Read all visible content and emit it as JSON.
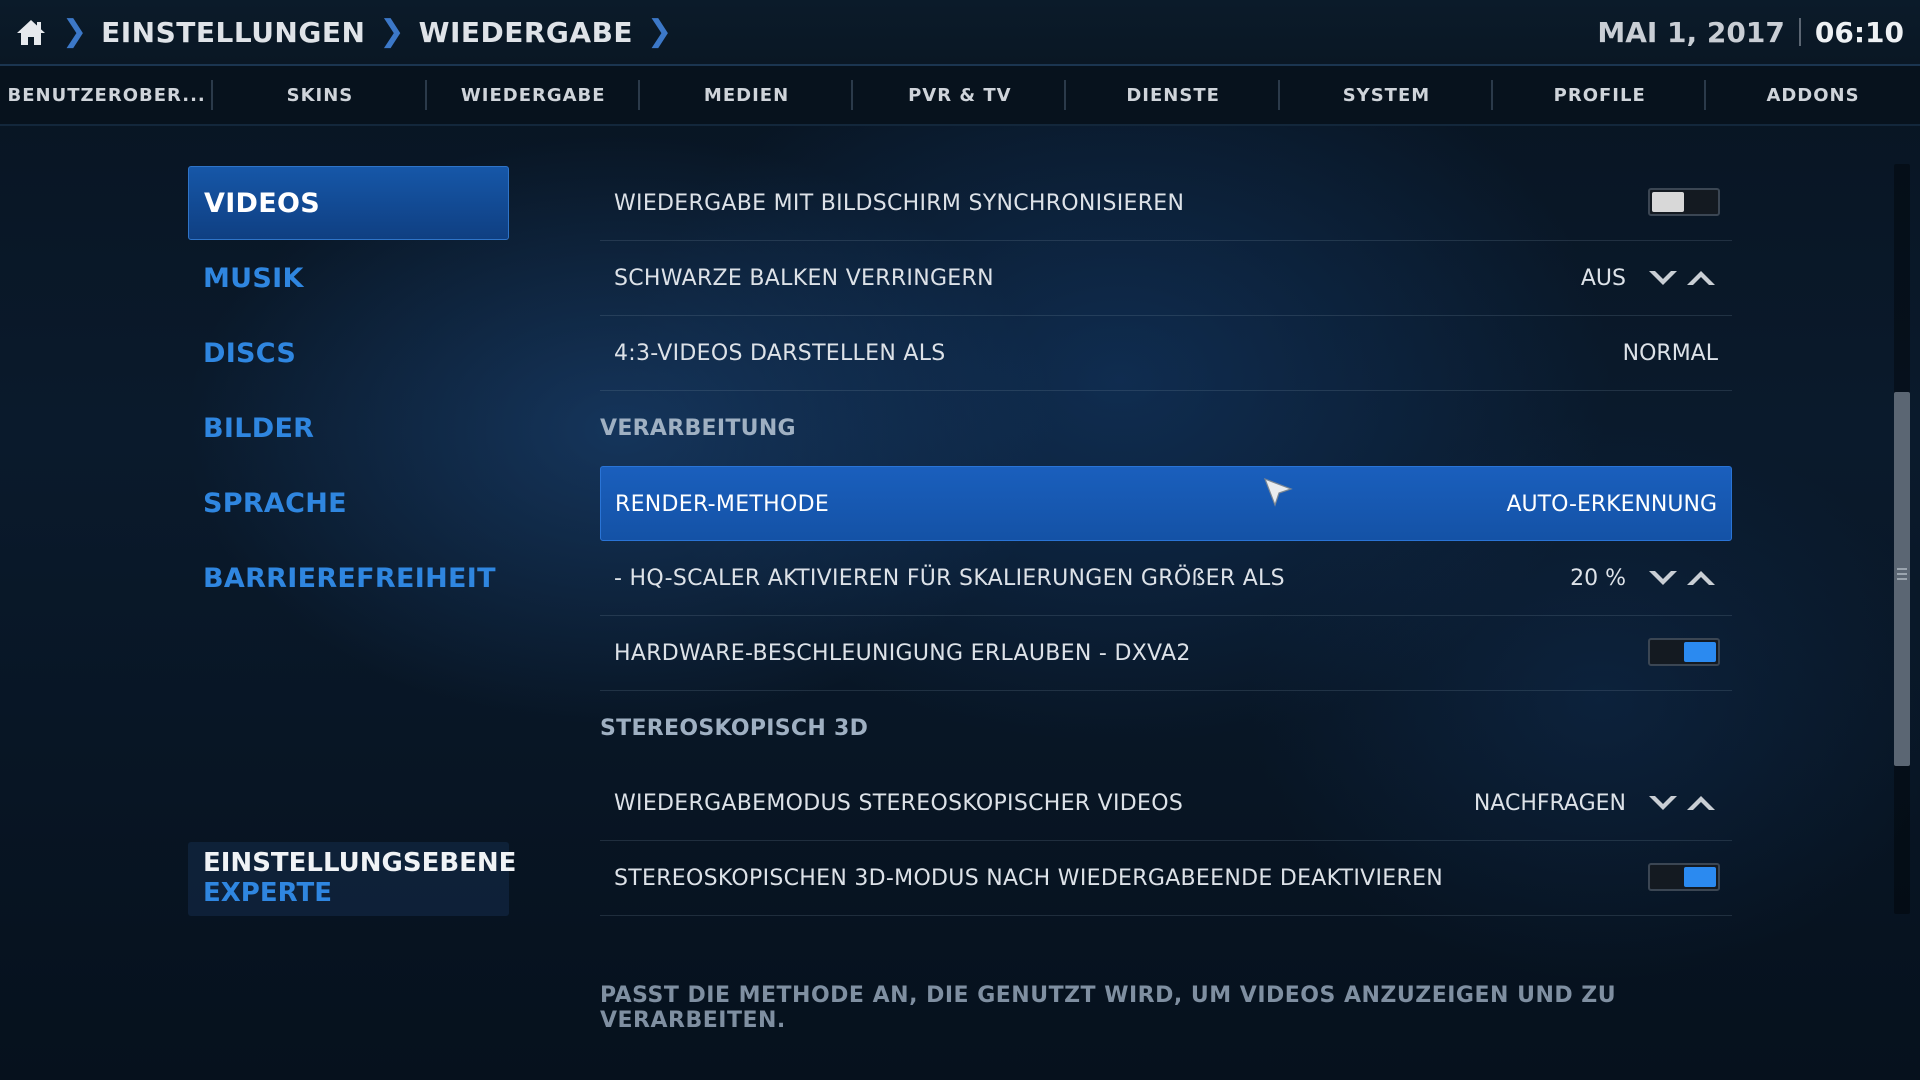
{
  "header": {
    "breadcrumbs": [
      "EINSTELLUNGEN",
      "WIEDERGABE"
    ],
    "date": "MAI 1, 2017",
    "time": "06:10"
  },
  "tabs": [
    {
      "label": "BENUTZEROBER...",
      "active": false
    },
    {
      "label": "SKINS",
      "active": false
    },
    {
      "label": "WIEDERGABE",
      "active": true
    },
    {
      "label": "MEDIEN",
      "active": false
    },
    {
      "label": "PVR & TV",
      "active": false
    },
    {
      "label": "DIENSTE",
      "active": false
    },
    {
      "label": "SYSTEM",
      "active": false
    },
    {
      "label": "PROFILE",
      "active": false
    },
    {
      "label": "ADDONS",
      "active": false
    }
  ],
  "categories": [
    {
      "label": "VIDEOS",
      "active": true
    },
    {
      "label": "MUSIK",
      "active": false
    },
    {
      "label": "DISCS",
      "active": false
    },
    {
      "label": "BILDER",
      "active": false
    },
    {
      "label": "SPRACHE",
      "active": false
    },
    {
      "label": "BARRIEREFREIHEIT",
      "active": false
    }
  ],
  "settings_level": {
    "title": "EINSTELLUNGSEBENE",
    "value": "EXPERTE"
  },
  "settings": [
    {
      "label": "WIEDERGABE MIT BILDSCHIRM SYNCHRONISIEREN",
      "type": "toggle",
      "checked": false
    },
    {
      "label": "SCHWARZE BALKEN VERRINGERN",
      "type": "spinner",
      "value": "AUS"
    },
    {
      "label": "4:3-VIDEOS DARSTELLEN ALS",
      "type": "value",
      "value": "NORMAL"
    },
    {
      "section": "VERARBEITUNG"
    },
    {
      "label": "RENDER-METHODE",
      "type": "value",
      "value": "AUTO-ERKENNUNG",
      "selected": true
    },
    {
      "label": "- HQ-SCALER AKTIVIEREN FÜR SKALIERUNGEN GRÖßER ALS",
      "type": "spinner",
      "value": "20 %"
    },
    {
      "label": "HARDWARE-BESCHLEUNIGUNG ERLAUBEN - DXVA2",
      "type": "toggle",
      "checked": true
    },
    {
      "section": "STEREOSKOPISCH 3D"
    },
    {
      "label": "WIEDERGABEMODUS STEREOSKOPISCHER VIDEOS",
      "type": "spinner",
      "value": "NACHFRAGEN"
    },
    {
      "label": "STEREOSKOPISCHEN 3D-MODUS NACH WIEDERGABEENDE DEAKTIVIEREN",
      "type": "toggle",
      "checked": true
    }
  ],
  "description": "PASST DIE METHODE AN, DIE GENUTZT WIRD, UM VIDEOS ANZUZEIGEN UND ZU VERARBEITEN.",
  "colors": {
    "accent": "#2f86e0",
    "selected_row": "#1a5fbd",
    "toggle_on": "#2b8af0"
  },
  "icons": {
    "home": "home-icon",
    "breadcrumb_separator": "chevron-right-icon",
    "spinner_down": "chevron-down-icon",
    "spinner_up": "chevron-up-icon",
    "pointer": "mouse-pointer-icon"
  }
}
